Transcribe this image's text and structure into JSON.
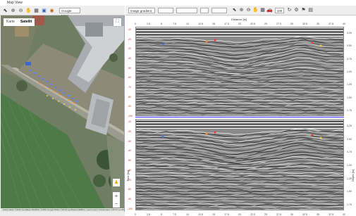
{
  "left_window": {
    "title": "Map View",
    "map_source": "Google Maps",
    "map_types": [
      "Karte",
      "Satellit"
    ],
    "active_map_type": "Satellit",
    "footer": "Kartendaten ©2019 GeoBasis-DE/BKG ©2009 Google  Bilder ©2019 GeoBasis-DE/BKG, GeoContent, Kartendaten ©2019 GeoBasis-DE/BKG ©2009  Nutzungsbedingungen"
  },
  "right_window": {
    "view_combo": "Image gradient",
    "zoom_level": "100",
    "x_axis_title": "Distance [m]",
    "x_ticks": [
      "0",
      "2.5",
      "5",
      "7.5",
      "10",
      "12.5",
      "15",
      "17.5",
      "20",
      "22.5",
      "25",
      "27.5",
      "30",
      "32.5",
      "35",
      "37.5",
      "40"
    ],
    "top_panel": {
      "left_ticks": [
        "-10",
        "-20",
        "-30",
        "-40",
        "-50",
        "-60",
        "-70",
        "-80",
        "-90",
        "-100"
      ],
      "right_ticks": [
        "0.25",
        "0.50",
        "0.75",
        "1.00",
        "1.25",
        "1.50",
        "1.75"
      ],
      "left_label": "Time [ns]",
      "right_label": "Depth [m]"
    },
    "bottom_panel": {
      "left_ticks": [
        "-10",
        "-20",
        "-30",
        "-40",
        "-50",
        "-60",
        "-70",
        "-80",
        "-90",
        "-100"
      ],
      "right_ticks": [
        "0.25",
        "0.50",
        "0.75",
        "1.00",
        "1.25",
        "1.50",
        "1.75"
      ],
      "left_label": "Time [ns]",
      "right_label": "Depth [m]"
    },
    "divider_color": "#2b2bff"
  }
}
